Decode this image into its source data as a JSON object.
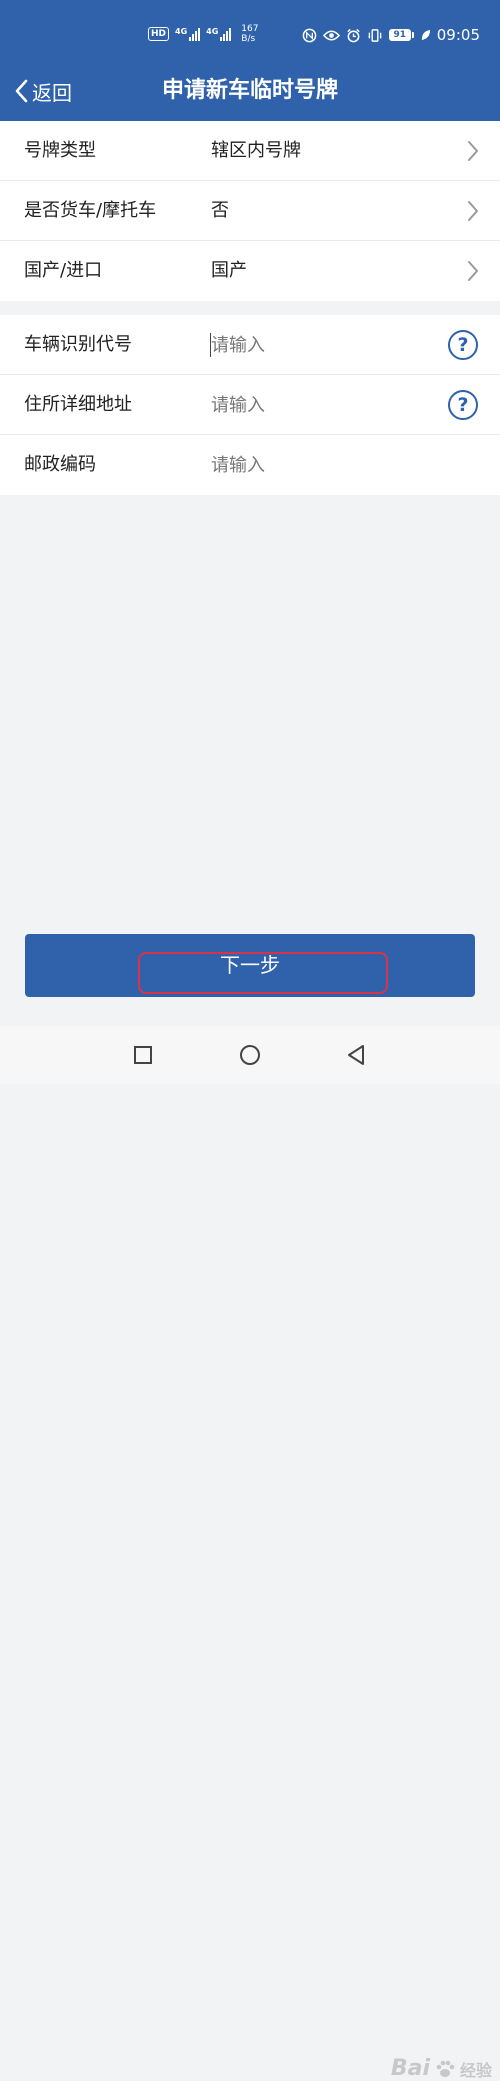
{
  "status_bar": {
    "hd_label": "HD",
    "sim1_label": "4G",
    "sim2_label": "4G",
    "net_speed_value": "167",
    "net_speed_unit": "B/s",
    "battery_level": "91",
    "time": "09:05"
  },
  "header": {
    "back_label": "返回",
    "title": "申请新车临时号牌",
    "bg_color": "#2f62ab"
  },
  "form_group_1": {
    "rows": [
      {
        "label": "号牌类型",
        "value": "辖区内号牌"
      },
      {
        "label": "是否货车/摩托车",
        "value": "否"
      },
      {
        "label": "国产/进口",
        "value": "国产"
      }
    ]
  },
  "form_group_2": {
    "rows": [
      {
        "label": "车辆识别代号",
        "placeholder": "请输入",
        "value": ""
      },
      {
        "label": "住所详细地址",
        "placeholder": "请输入",
        "value": ""
      },
      {
        "label": "邮政编码",
        "placeholder": "请输入",
        "value": ""
      }
    ]
  },
  "help_icon_glyph": "?",
  "footer": {
    "next_label": "下一步",
    "highlight_color": "#d9334a"
  },
  "icons": {
    "back": "chevron-left-icon",
    "row_arrow": "chevron-right-icon",
    "help": "question-circle-icon",
    "nav_recent": "square-icon",
    "nav_home": "circle-icon",
    "nav_back": "triangle-back-icon"
  },
  "watermark": {
    "brand": "Bai",
    "sub": "经验"
  }
}
